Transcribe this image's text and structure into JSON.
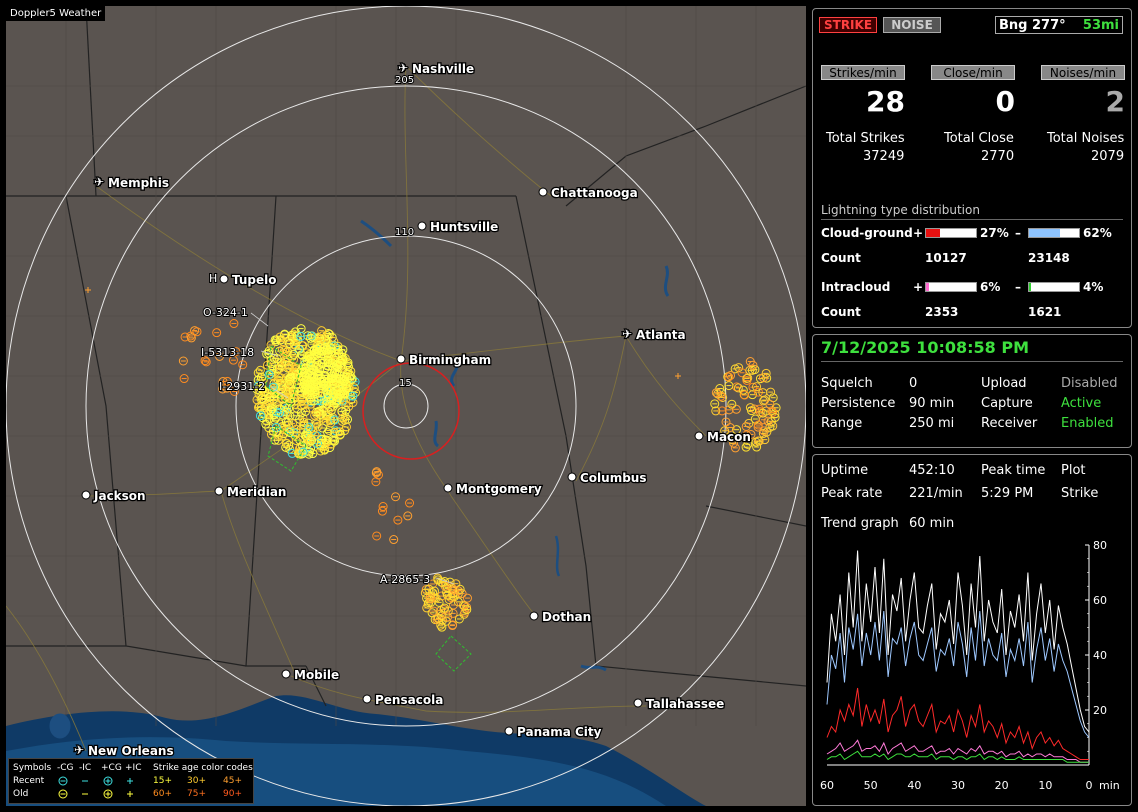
{
  "app": {
    "title": "Doppler5 Weather"
  },
  "map": {
    "cities": [
      {
        "name": "Nashville",
        "airport": true
      },
      {
        "name": "Memphis",
        "airport": true
      },
      {
        "name": "Chattanooga",
        "airport": false
      },
      {
        "name": "Huntsville",
        "airport": false
      },
      {
        "name": "Tupelo",
        "airport": false
      },
      {
        "name": "Birmingham",
        "airport": false
      },
      {
        "name": "Atlanta",
        "airport": true
      },
      {
        "name": "Macon",
        "airport": false
      },
      {
        "name": "Jackson",
        "airport": false
      },
      {
        "name": "Meridian",
        "airport": false
      },
      {
        "name": "Montgomery",
        "airport": false
      },
      {
        "name": "Columbus",
        "airport": false
      },
      {
        "name": "Dothan",
        "airport": false
      },
      {
        "name": "Mobile",
        "airport": false
      },
      {
        "name": "Pensacola",
        "airport": false
      },
      {
        "name": "Tallahassee",
        "airport": false
      },
      {
        "name": "Panama City",
        "airport": false
      },
      {
        "name": "New Orleans",
        "airport": true
      }
    ],
    "ring_labels": {
      "outer": "205",
      "middle": "110",
      "inner": "15"
    },
    "track_labels": {
      "t1": "O-324-1",
      "t2": "I-5313-18",
      "t3": "I-2931-2",
      "t4": "A-2865-3",
      "t5": "H"
    },
    "legend": {
      "symbols": "Symbols",
      "cols": [
        "-CG",
        "-IC",
        "+CG",
        "+IC"
      ],
      "age_title": "Strike age color codes",
      "recent": "Recent",
      "old": "Old",
      "recent_ages": [
        "15+",
        "30+",
        "45+"
      ],
      "old_ages": [
        "60+",
        "75+",
        "90+"
      ]
    }
  },
  "status": {
    "strike_label": "STRIKE",
    "noise_label": "NOISE",
    "bearing": "Bng 277°",
    "distance": "53mi",
    "rate_headers": {
      "strikes": "Strikes/min",
      "close": "Close/min",
      "noises": "Noises/min"
    },
    "rates": {
      "strikes": "28",
      "close": "0",
      "noises": "2"
    },
    "total_labels": {
      "strikes": "Total Strikes",
      "close": "Total Close",
      "noises": "Total Noises"
    },
    "totals": {
      "strikes": "37249",
      "close": "2770",
      "noises": "2079"
    },
    "dist_title": "Lightning type distribution",
    "cloud_ground": {
      "label": "Cloud-ground",
      "pos_pct": "27%",
      "neg_pct": "62%",
      "pos_frac": 0.27,
      "neg_frac": 0.62,
      "count_label": "Count",
      "pos_count": "10127",
      "neg_count": "23148"
    },
    "intracloud": {
      "label": "Intracloud",
      "pos_pct": "6%",
      "neg_pct": "4%",
      "pos_frac": 0.06,
      "neg_frac": 0.04,
      "count_label": "Count",
      "pos_count": "2353",
      "neg_count": "1621"
    },
    "plus": "+",
    "minus": "–"
  },
  "info": {
    "datetime": "7/12/2025 10:08:58 PM",
    "rows": [
      {
        "k1": "Squelch",
        "v1": "0",
        "k2": "Upload",
        "v2": "Disabled"
      },
      {
        "k1": "Persistence",
        "v1": "90 min",
        "k2": "Capture",
        "v2": "Active"
      },
      {
        "k1": "Range",
        "v1": "250 mi",
        "k2": "Receiver",
        "v2": "Enabled"
      }
    ]
  },
  "trend": {
    "uptime_label": "Uptime",
    "uptime": "452:10",
    "peak_time_label": "Peak time",
    "peak_time": "5:29 PM",
    "plot_label": "Plot",
    "plot": "Strike",
    "peak_rate_label": "Peak rate",
    "peak_rate": "221/min",
    "graph_label": "Trend graph",
    "graph_span": "60 min",
    "y_ticks": [
      "80",
      "60",
      "40",
      "20"
    ],
    "x_ticks": [
      "60",
      "50",
      "40",
      "30",
      "20",
      "10",
      "0"
    ],
    "x_unit": "min"
  },
  "chart_data": {
    "type": "line",
    "xlabel": "min",
    "xlim": [
      60,
      0
    ],
    "ylim": [
      0,
      80
    ],
    "x": [
      60,
      59,
      58,
      57,
      56,
      55,
      54,
      53,
      52,
      51,
      50,
      49,
      48,
      47,
      46,
      45,
      44,
      43,
      42,
      41,
      40,
      39,
      38,
      37,
      36,
      35,
      34,
      33,
      32,
      31,
      30,
      29,
      28,
      27,
      26,
      25,
      24,
      23,
      22,
      21,
      20,
      19,
      18,
      17,
      16,
      15,
      14,
      13,
      12,
      11,
      10,
      9,
      8,
      7,
      6,
      5,
      4,
      3,
      2,
      1,
      0
    ],
    "series": [
      {
        "color": "#ffffff",
        "values": [
          30,
          55,
          45,
          62,
          40,
          70,
          50,
          78,
          45,
          66,
          52,
          72,
          48,
          75,
          40,
          62,
          56,
          68,
          45,
          60,
          70,
          50,
          48,
          58,
          66,
          42,
          55,
          52,
          60,
          44,
          70,
          58,
          40,
          66,
          50,
          76,
          45,
          60,
          52,
          48,
          64,
          40,
          56,
          50,
          62,
          45,
          70,
          38,
          55,
          66,
          48,
          60,
          42,
          58,
          50,
          44,
          36,
          28,
          20,
          14,
          12
        ]
      },
      {
        "color": "#9ec8ff",
        "values": [
          22,
          40,
          35,
          48,
          30,
          50,
          42,
          55,
          36,
          48,
          40,
          52,
          38,
          56,
          32,
          46,
          44,
          50,
          36,
          46,
          52,
          40,
          38,
          44,
          50,
          34,
          42,
          40,
          46,
          36,
          52,
          44,
          32,
          50,
          38,
          56,
          36,
          46,
          40,
          38,
          48,
          32,
          42,
          38,
          46,
          36,
          52,
          30,
          42,
          50,
          38,
          46,
          34,
          44,
          38,
          34,
          28,
          22,
          16,
          12,
          10
        ]
      },
      {
        "color": "#ff2a2a",
        "values": [
          10,
          14,
          12,
          20,
          16,
          22,
          18,
          28,
          14,
          22,
          16,
          20,
          15,
          24,
          12,
          18,
          20,
          25,
          14,
          20,
          22,
          16,
          14,
          18,
          22,
          12,
          16,
          15,
          18,
          12,
          20,
          16,
          10,
          18,
          14,
          22,
          12,
          16,
          14,
          10,
          15,
          8,
          12,
          10,
          14,
          8,
          12,
          6,
          10,
          12,
          8,
          10,
          7,
          9,
          6,
          5,
          4,
          3,
          2,
          2,
          2
        ]
      },
      {
        "color": "#ff7ad8",
        "values": [
          4,
          5,
          6,
          8,
          5,
          6,
          7,
          9,
          5,
          6,
          6,
          7,
          5,
          8,
          4,
          6,
          7,
          8,
          5,
          6,
          7,
          5,
          5,
          6,
          7,
          4,
          5,
          5,
          6,
          4,
          6,
          5,
          4,
          6,
          5,
          7,
          4,
          5,
          5,
          4,
          5,
          3,
          4,
          4,
          5,
          3,
          4,
          3,
          4,
          4,
          3,
          4,
          3,
          3,
          3,
          2,
          2,
          2,
          1,
          1,
          1
        ]
      },
      {
        "color": "#3ee03e",
        "values": [
          2,
          3,
          3,
          4,
          2,
          3,
          4,
          5,
          3,
          3,
          3,
          4,
          3,
          4,
          2,
          3,
          4,
          4,
          3,
          3,
          4,
          3,
          3,
          3,
          4,
          2,
          3,
          3,
          3,
          2,
          3,
          3,
          2,
          3,
          3,
          4,
          2,
          3,
          3,
          2,
          3,
          2,
          2,
          2,
          3,
          2,
          2,
          2,
          2,
          2,
          2,
          2,
          2,
          2,
          2,
          1,
          1,
          1,
          1,
          1,
          1
        ]
      }
    ]
  }
}
